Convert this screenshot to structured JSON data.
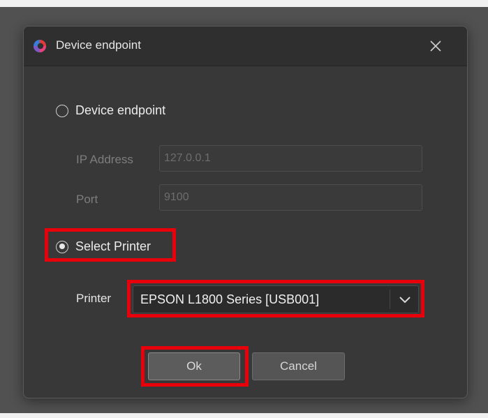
{
  "window": {
    "title": "Device endpoint",
    "close_icon": "close-icon",
    "app_icon": "app-logo-icon"
  },
  "endpoint_option": {
    "label": "Device endpoint",
    "checked": false
  },
  "ip_address": {
    "label": "IP Address",
    "value": "127.0.0.1",
    "disabled": true
  },
  "port": {
    "label": "Port",
    "value": "9100",
    "disabled": true
  },
  "printer_option": {
    "label": "Select Printer",
    "checked": true
  },
  "printer_select": {
    "label": "Printer",
    "value": "EPSON L1800 Series [USB001]",
    "arrow_icon": "chevron-down-icon"
  },
  "buttons": {
    "ok": "Ok",
    "cancel": "Cancel"
  },
  "colors": {
    "highlight": "#e8000b",
    "dialog_bg": "#383838",
    "titlebar_bg": "#2f2f2f"
  }
}
